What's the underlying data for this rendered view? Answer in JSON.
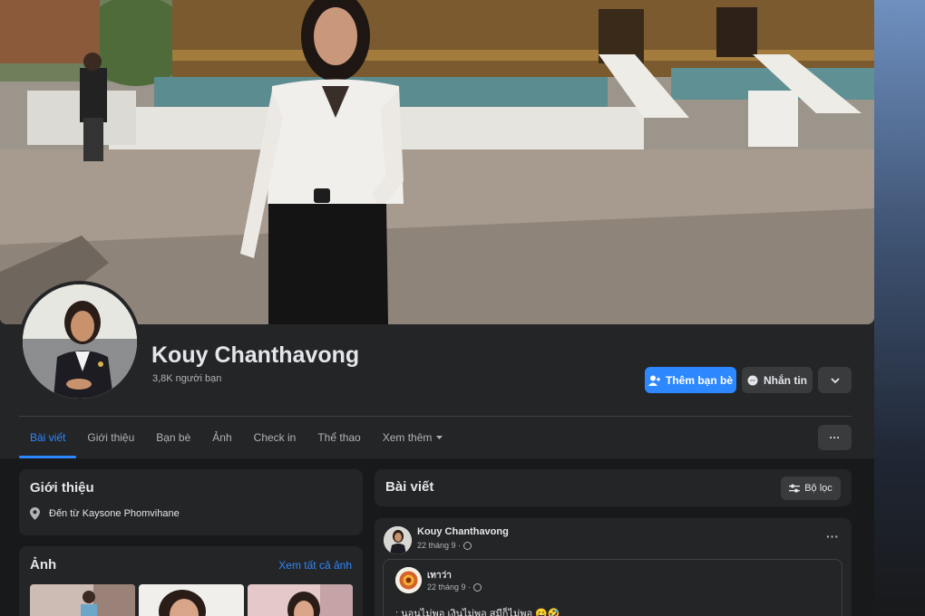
{
  "profile": {
    "name": "Kouy Chanthavong",
    "friends": "3,8K người bạn"
  },
  "actions": {
    "add_friend": "Thêm bạn bè",
    "message": "Nhắn tin",
    "more_icon": "chevron-down-icon"
  },
  "tabs": [
    {
      "label": "Bài viết",
      "active": true
    },
    {
      "label": "Giới thiệu"
    },
    {
      "label": "Bạn bè"
    },
    {
      "label": "Ảnh"
    },
    {
      "label": "Check in"
    },
    {
      "label": "Thể thao"
    },
    {
      "label": "Xem thêm"
    }
  ],
  "tabs_more": "···",
  "intro": {
    "title": "Giới thiệu",
    "from": "Đến từ Kaysone Phomvihane"
  },
  "photos": {
    "title": "Ảnh",
    "see_all": "Xem tất cả ảnh"
  },
  "posts": {
    "title": "Bài viết",
    "filter": "Bộ lọc"
  },
  "post": {
    "author": "Kouy Chanthavong",
    "date": "22 tháng 9 ·",
    "menu": "···",
    "shared": {
      "author": "เทาว่า",
      "date": "22 tháng 9 ·",
      "text": ": นอนไม่พอ เงินไม่พอ สมีก็ไม่พอ 😄🤣"
    }
  },
  "colors": {
    "accent": "#2d88ff",
    "background": "#18191a",
    "card": "#242526"
  }
}
